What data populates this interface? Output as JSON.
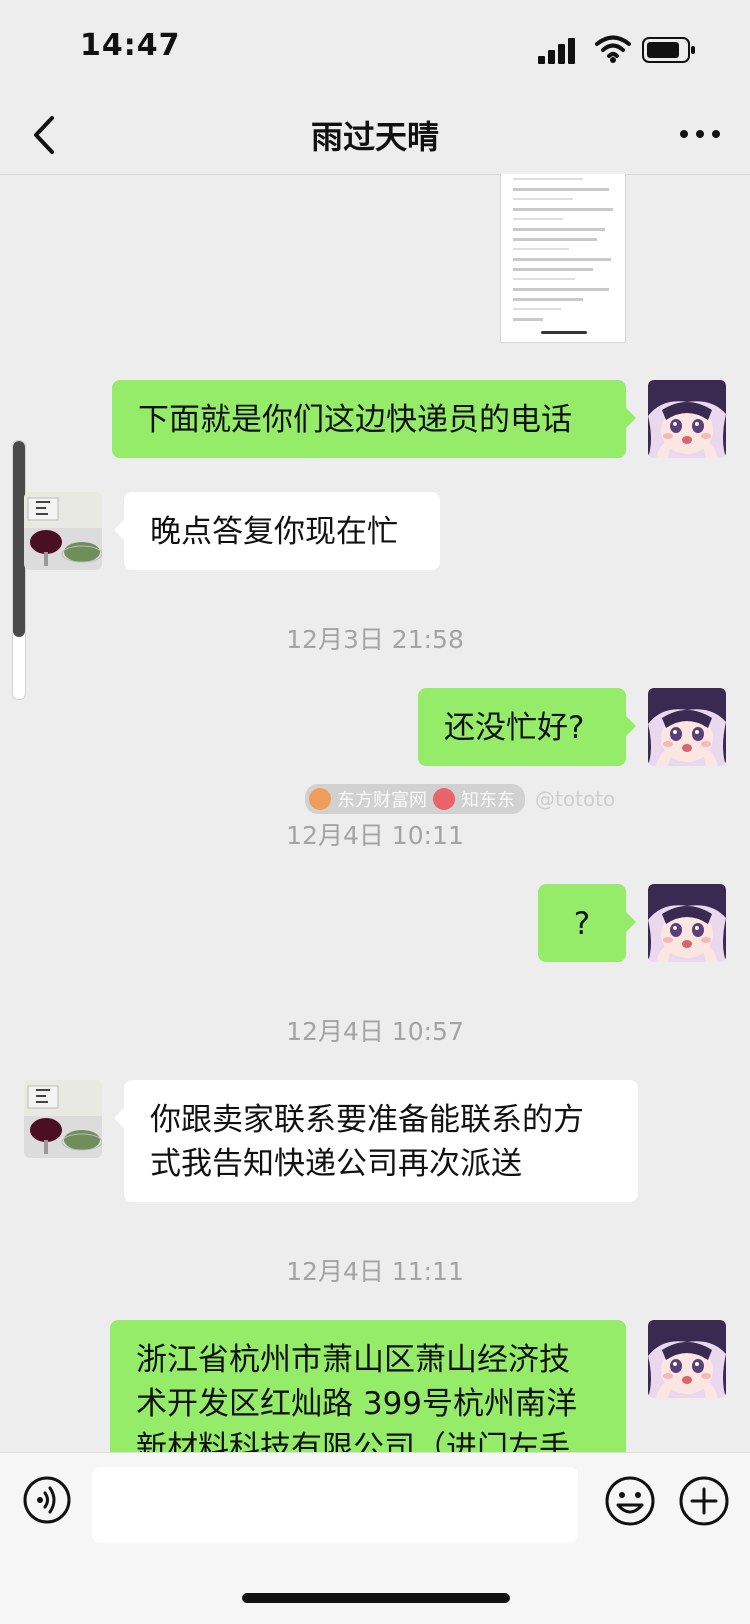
{
  "status_bar": {
    "time": "14:47"
  },
  "header": {
    "title": "雨过天晴"
  },
  "messages": {
    "m1": "下面就是你们这边快递员的电话",
    "m2": "晚点答复你现在忙",
    "t1": "12月3日 21:58",
    "m3": "还没忙好?",
    "t2": "12月4日 10:11",
    "m4": "?",
    "t3": "12月4日 10:57",
    "m5_line1": "你跟卖家联系要准备能联系的方",
    "m5_line2": "式我告知快递公司再次派送",
    "t4": "12月4日 11:11",
    "m6_line1": "浙江省杭州市萧山区萧山经济技",
    "m6_line2": "术开发区红灿路 399号杭州南洋",
    "m6_line3": "新材料科技有限公司（进门左手"
  },
  "watermark": {
    "brand1": "东方财富网",
    "brand2": "知东东",
    "handle": "@tototo"
  },
  "icons": {
    "back": "chevron-left-icon",
    "more": "more-icon",
    "voice": "voice-icon",
    "emoji": "emoji-icon",
    "plus": "plus-icon",
    "signal": "signal-icon",
    "wifi": "wifi-icon",
    "battery": "battery-icon"
  },
  "colors": {
    "background": "#ededed",
    "my_bubble": "#95ec69",
    "other_bubble": "#ffffff",
    "timestamp": "#a4a4a4"
  }
}
